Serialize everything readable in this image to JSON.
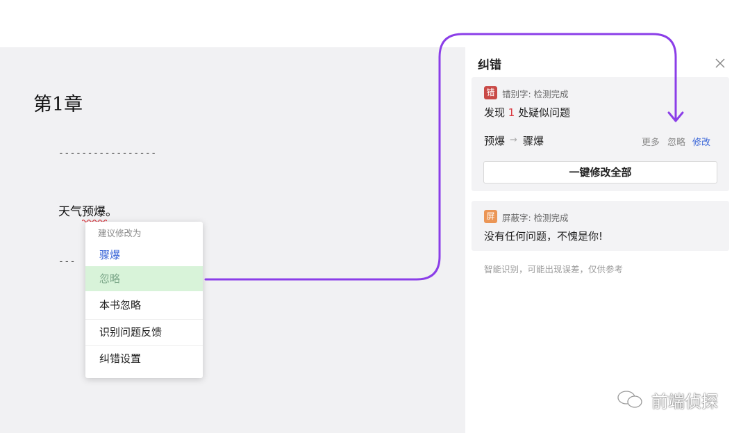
{
  "editor": {
    "chapter_title": "第1章",
    "divider": "-----------------",
    "divider_partial": "---",
    "paragraph_prefix": "天气",
    "typo_word": "预爆",
    "paragraph_suffix": "。"
  },
  "context_menu": {
    "heading": "建议修改为",
    "suggestion": "骤爆",
    "ignore": "忽略",
    "ignore_in_book": "本书忽略",
    "feedback": "识别问题反馈",
    "settings": "纠错设置"
  },
  "panel": {
    "title": "纠错",
    "typo_card": {
      "badge": "错",
      "label": "错别字: 检测完成",
      "found_prefix": "发现",
      "count": "1",
      "found_suffix": "处疑似问题",
      "original": "预爆",
      "arrow": "→",
      "replacement": "骤爆",
      "more": "更多",
      "ignore": "忽略",
      "modify": "修改",
      "fix_all": "一键修改全部"
    },
    "blocked_card": {
      "badge": "屏",
      "label": "屏蔽字: 检测完成",
      "message": "没有任何问题，不愧是你!"
    },
    "hint": "智能识别，可能出现误差，仅供参考"
  },
  "watermark": "前端侦探",
  "colors": {
    "accent_blue": "#3a66d8",
    "error_red": "#c94a47",
    "warning_orange": "#eb9656",
    "connector_purple": "#8b3ee8",
    "ignore_highlight": "#d8f3d9"
  }
}
